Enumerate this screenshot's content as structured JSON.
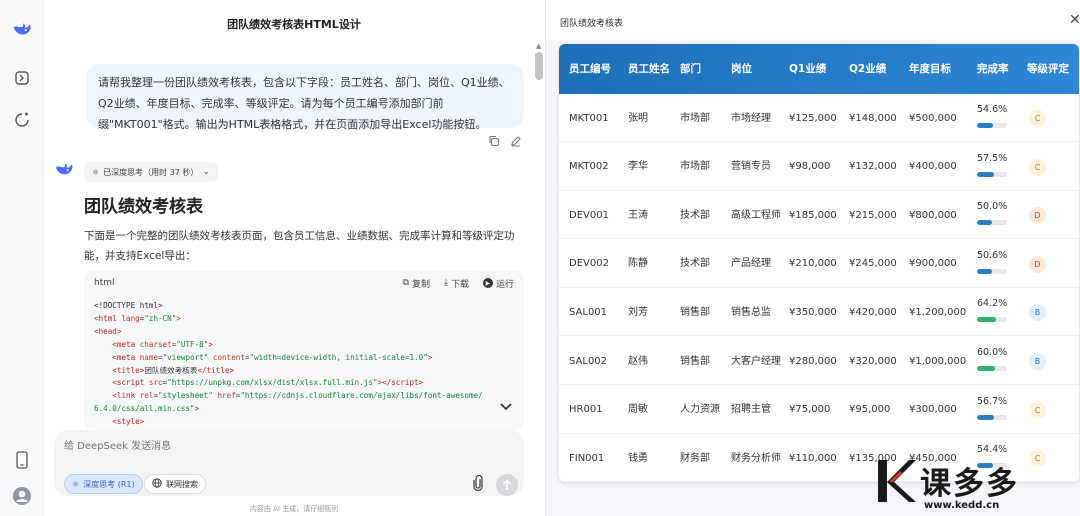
{
  "chat": {
    "title": "团队绩效考核表HTML设计",
    "user_message": "请帮我整理一份团队绩效考核表，包含以下字段：员工姓名、部门、岗位、Q1业绩、Q2业绩、年度目标、完成率、等级评定。请为每个员工编号添加部门前缀\"MKT001\"格式。输出为HTML表格格式，并在页面添加导出Excel功能按钮。",
    "thinking_label": "已深度思考（用时 37 秒）",
    "heading": "团队绩效考核表",
    "intro": "下面是一个完整的团队绩效考核表页面，包含员工信息、业绩数据、完成率计算和等级评定功能，并支持Excel导出：",
    "code": {
      "lang": "html",
      "copy_label": "复制",
      "download_label": "下载",
      "run_label": "运行"
    },
    "composer": {
      "placeholder": "给 DeepSeek 发送消息",
      "deep_think_label": "深度思考 (R1)",
      "web_search_label": "联网搜索"
    },
    "footnote": "内容由 AI 生成，请仔细甄别"
  },
  "preview": {
    "title": "团队绩效考核表",
    "columns": [
      "员工编号",
      "员工姓名",
      "部门",
      "岗位",
      "Q1业绩",
      "Q2业绩",
      "年度目标",
      "完成率",
      "等级评定"
    ],
    "rows": [
      {
        "id": "MKT001",
        "name": "张明",
        "dept": "市场部",
        "role": "市场经理",
        "q1": "¥125,000",
        "q2": "¥148,000",
        "target": "¥500,000",
        "rate": "54.6%",
        "rate_value": 54.6,
        "grade": "C"
      },
      {
        "id": "MKT002",
        "name": "李华",
        "dept": "市场部",
        "role": "营销专员",
        "q1": "¥98,000",
        "q2": "¥132,000",
        "target": "¥400,000",
        "rate": "57.5%",
        "rate_value": 57.5,
        "grade": "C"
      },
      {
        "id": "DEV001",
        "name": "王涛",
        "dept": "技术部",
        "role": "高级工程师",
        "q1": "¥185,000",
        "q2": "¥215,000",
        "target": "¥800,000",
        "rate": "50.0%",
        "rate_value": 50.0,
        "grade": "D"
      },
      {
        "id": "DEV002",
        "name": "陈静",
        "dept": "技术部",
        "role": "产品经理",
        "q1": "¥210,000",
        "q2": "¥245,000",
        "target": "¥900,000",
        "rate": "50.6%",
        "rate_value": 50.6,
        "grade": "D"
      },
      {
        "id": "SAL001",
        "name": "刘芳",
        "dept": "销售部",
        "role": "销售总监",
        "q1": "¥350,000",
        "q2": "¥420,000",
        "target": "¥1,200,000",
        "rate": "64.2%",
        "rate_value": 64.2,
        "grade": "B"
      },
      {
        "id": "SAL002",
        "name": "赵伟",
        "dept": "销售部",
        "role": "大客户经理",
        "q1": "¥280,000",
        "q2": "¥320,000",
        "target": "¥1,000,000",
        "rate": "60.0%",
        "rate_value": 60.0,
        "grade": "B"
      },
      {
        "id": "HR001",
        "name": "周敏",
        "dept": "人力资源",
        "role": "招聘主管",
        "q1": "¥75,000",
        "q2": "¥95,000",
        "target": "¥300,000",
        "rate": "56.7%",
        "rate_value": 56.7,
        "grade": "C"
      },
      {
        "id": "FIN001",
        "name": "钱勇",
        "dept": "财务部",
        "role": "财务分析师",
        "q1": "¥110,000",
        "q2": "¥135,000",
        "target": "¥450,000",
        "rate": "54.4%",
        "rate_value": 54.4,
        "grade": "C"
      }
    ],
    "grade_colors": {
      "B": {
        "bg": "#e3f0fb",
        "fg": "#2b6fb0",
        "bar": "#2fb36b"
      },
      "C": {
        "bg": "#fdf3dc",
        "fg": "#b8860b",
        "bar": "#2a7fc1"
      },
      "D": {
        "bg": "#fde8dc",
        "fg": "#c0502a",
        "bar": "#2a7fc1"
      }
    }
  },
  "watermark": {
    "brand": "课多多",
    "url": "www.kedd.cn"
  }
}
